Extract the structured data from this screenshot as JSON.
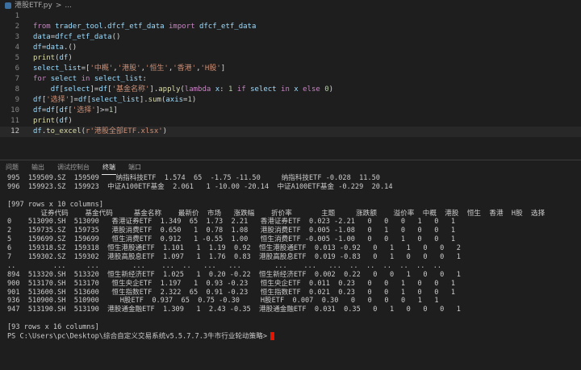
{
  "breadcrumb": {
    "file": "港股ETF.py",
    "sep": " > ",
    "more": "..."
  },
  "editor": {
    "active_line": 12,
    "lines": [
      {
        "n": "1",
        "t": ""
      },
      {
        "n": "2",
        "t": "from trader_tool.dfcf_etf_data import dfcf_etf_data"
      },
      {
        "n": "3",
        "t": "data=dfcf_etf_data()"
      },
      {
        "n": "4",
        "t": "df=data.get_all_etf_data_1()"
      },
      {
        "n": "5",
        "t": "print(df)"
      },
      {
        "n": "6",
        "t": "select_list=['中概','港股','恒生','香港','H股']"
      },
      {
        "n": "7",
        "t": "for select in select_list:"
      },
      {
        "n": "8",
        "t": "    df[select]=df['基金名称'].apply(lambda x: 1 if select in x else 0)"
      },
      {
        "n": "9",
        "t": "df['选择']=df[select_list].sum(axis=1)"
      },
      {
        "n": "10",
        "t": "df=df[df['选择']>=1]"
      },
      {
        "n": "11",
        "t": "print(df)"
      },
      {
        "n": "12",
        "t": "df.to_excel(r'港股全部ETF.xlsx')"
      }
    ]
  },
  "panel": {
    "tabs": [
      "问题",
      "输出",
      "调试控制台",
      "终端",
      "端口"
    ],
    "active_tab": "终端"
  },
  "terminal": {
    "lines": [
      "995  159509.SZ  159509    纳指科技ETF  1.574  65  -1.75 -11.50     纳指科技ETF -0.028  11.50",
      "996  159923.SZ  159923  中证A100ETF基金  2.061   1 -10.00 -20.14  中证A100ETF基金 -0.229  20.14",
      "",
      "[997 rows x 10 columns]",
      "        证券代码    基金代码     基金名称    最新价  市场   涨跌幅    折价率       主题     涨跌额    溢价率  中概  港股  恒生  香港  H股  选择",
      "0    513090.SH  513090   香港证券ETF  1.349  65  1.73  2.21   香港证券ETF  0.023 -2.21   0   0   0   1   0   1",
      "2    159735.SZ  159735   港股消费ETF  0.650   1  0.78  1.08   港股消费ETF  0.005 -1.08   0   1   0   0   0   1",
      "5    159699.SZ  159699   恒生消费ETF  0.912   1 -0.55  1.00   恒生消费ETF -0.005 -1.00   0   0   1   0   0   1",
      "6    159318.SZ  159318  恒生港股通ETF  1.101   1  1.19  0.92  恒生港股通ETF  0.013 -0.92   0   1   1   0   0   2",
      "7    159302.SZ  159302  港股高股息ETF  1.097   1  1.76  0.83  港股高股息ETF  0.019 -0.83   0   1   0   0   0   1",
      "..         ...     ...        ...    ...  ..   ...   ...        ...    ...   ...  ..  ..  ..  ..  ..  ..",
      "894  513320.SH  513320  恒生新经济ETF  1.025   1  0.20 -0.22  恒生新经济ETF  0.002  0.22   0   0   1   0   0   1",
      "900  513170.SH  513170   恒生央企ETF  1.197   1  0.93 -0.23   恒生央企ETF  0.011  0.23   0   0   1   0   0   1",
      "901  513600.SH  513600   恒生指数ETF  2.322  65  0.91 -0.23   恒生指数ETF  0.021  0.23   0   0   1   0   0   1",
      "936  510900.SH  510900     H股ETF  0.937  65  0.75 -0.30     H股ETF  0.007  0.30   0   0   0   0   1   1",
      "947  513190.SH  513190  港股通金融ETF  1.309   1  2.43 -0.35  港股通金融ETF  0.031  0.35   0   1   0   0   0   1",
      "",
      "[93 rows x 16 columns]",
      "PS C:\\Users\\pc\\Desktop\\综合自定义交易系统v5.5.7.7.3牛市行业轮动策略>"
    ]
  }
}
